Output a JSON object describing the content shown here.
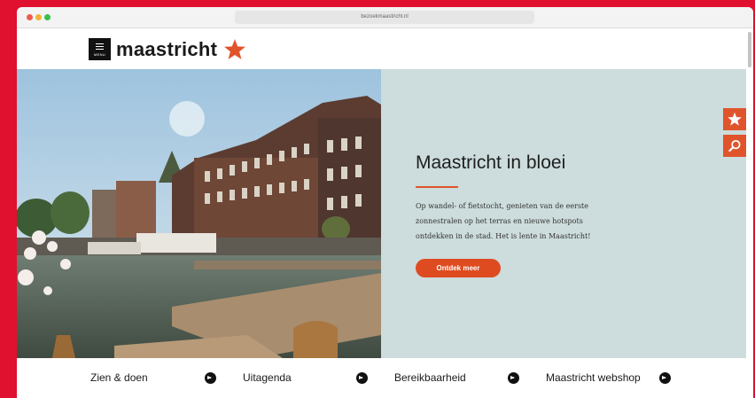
{
  "browser": {
    "url": "bezoekmaastricht.nl"
  },
  "header": {
    "menu_label": "MENU",
    "logo_text": "maastricht",
    "logo_icon": "star-icon"
  },
  "hero": {
    "title": "Maastricht in bloei",
    "text_lines": [
      "Op wandel- of fietstocht, genieten van de eerste",
      "zonnestralen op het terras en nieuwe hotspots",
      "ontdekken in de stad. Het is lente in Maastricht!"
    ],
    "button_label": "Ontdek meer"
  },
  "side_buttons": [
    {
      "icon": "star-icon"
    },
    {
      "icon": "search-icon"
    }
  ],
  "bottom_nav": [
    {
      "label": "Zien & doen",
      "icon": "arrow-right-circle-icon"
    },
    {
      "label": "Uitagenda",
      "icon": "arrow-right-circle-icon"
    },
    {
      "label": "Bereikbaarheid",
      "icon": "arrow-right-circle-icon"
    },
    {
      "label": "Maastricht webshop",
      "icon": "arrow-right-circle-icon"
    }
  ],
  "colors": {
    "frame": "#e0102f",
    "accent": "#df4b21",
    "hero_panel": "#cddcdc"
  }
}
